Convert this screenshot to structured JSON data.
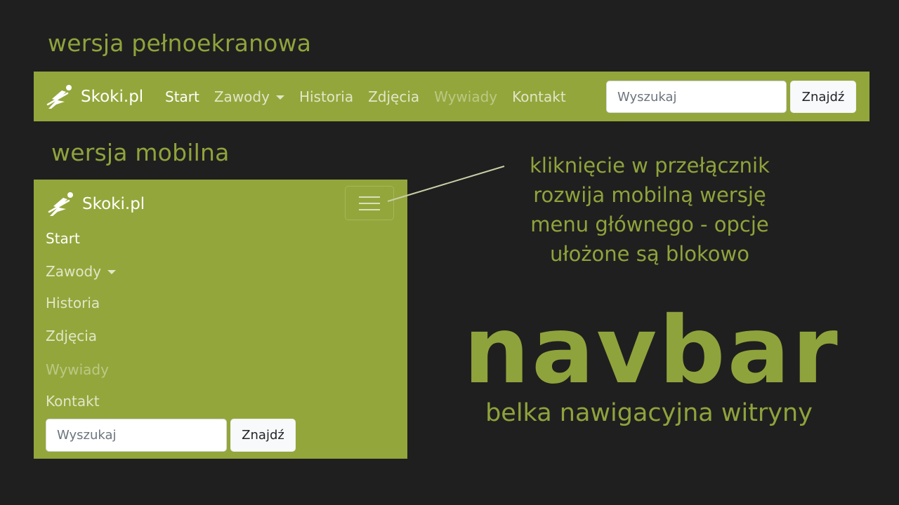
{
  "colors": {
    "background": "#1f1f1f",
    "navbar": "#93a63b",
    "accent_text": "#8fa33c"
  },
  "headings": {
    "desktop": "wersja pełnoekranowa",
    "mobile": "wersja mobilna"
  },
  "brand": {
    "name": "Skoki.pl",
    "icon": "ski-jumper-logo"
  },
  "nav": {
    "items": [
      {
        "label": "Start",
        "state": "active"
      },
      {
        "label": "Zawody",
        "state": "dropdown"
      },
      {
        "label": "Historia",
        "state": "normal"
      },
      {
        "label": "Zdjęcia",
        "state": "normal"
      },
      {
        "label": "Wywiady",
        "state": "disabled"
      },
      {
        "label": "Kontakt",
        "state": "normal"
      }
    ]
  },
  "search": {
    "placeholder": "Wyszukaj",
    "button_label": "Znajdź"
  },
  "toggler": {
    "icon": "hamburger-icon"
  },
  "annotation": {
    "lines": [
      "kliknięcie w przełącznik",
      "rozwija mobilną wersję",
      "menu głównego - opcje",
      "ułożone są blokowo"
    ]
  },
  "title": "navbar",
  "subtitle": "belka nawigacyjna witryny"
}
